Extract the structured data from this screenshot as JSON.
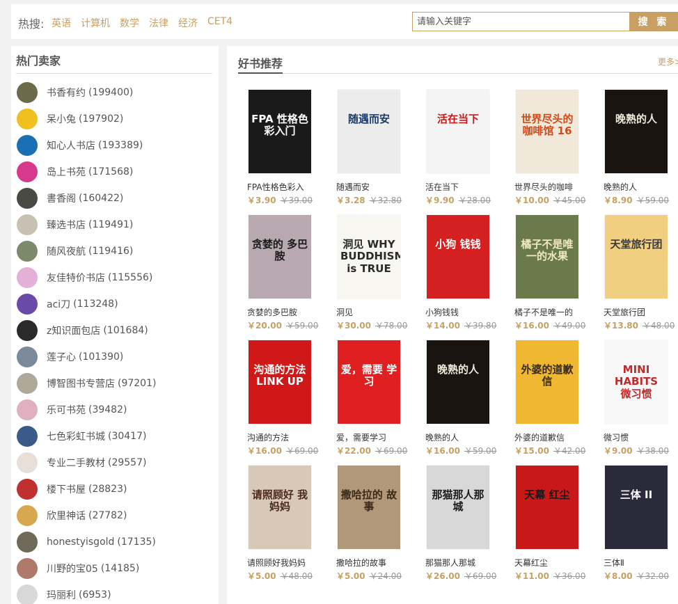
{
  "topbar": {
    "hot_label": "热搜:",
    "hot_tags": [
      "英语",
      "计算机",
      "数学",
      "法律",
      "经济",
      "CET4"
    ],
    "search_placeholder": "请输入关键字",
    "search_button": "搜 索"
  },
  "sidebar": {
    "title": "热门卖家",
    "sellers": [
      {
        "name": "书香有约",
        "count": "(199400)",
        "avatar_color": "#6b6b4a"
      },
      {
        "name": "呆小兔",
        "count": "(197902)",
        "avatar_color": "#f0c020"
      },
      {
        "name": "知心人书店",
        "count": "(193389)",
        "avatar_color": "#1b6fb3"
      },
      {
        "name": "岛上书苑",
        "count": "(171568)",
        "avatar_color": "#d63a8f"
      },
      {
        "name": "書香阁",
        "count": "(160422)",
        "avatar_color": "#4a4a44"
      },
      {
        "name": "臻选书店",
        "count": "(119491)",
        "avatar_color": "#c9c0b4"
      },
      {
        "name": "随风夜航",
        "count": "(119416)",
        "avatar_color": "#7a8a6a"
      },
      {
        "name": "友佳特价书店",
        "count": "(115556)",
        "avatar_color": "#e3b0d8"
      },
      {
        "name": "aci刀",
        "count": "(113248)",
        "avatar_color": "#6a4aa8"
      },
      {
        "name": "z知识面包店",
        "count": "(101684)",
        "avatar_color": "#2a2a2a"
      },
      {
        "name": "莲子心",
        "count": "(101390)",
        "avatar_color": "#7a8a9a"
      },
      {
        "name": "博智图书专营店",
        "count": "(97201)",
        "avatar_color": "#b0a898"
      },
      {
        "name": "乐可书苑",
        "count": "(39482)",
        "avatar_color": "#e0b0c0"
      },
      {
        "name": "七色彩虹书城",
        "count": "(30417)",
        "avatar_color": "#3a5a8a"
      },
      {
        "name": "专业二手教材",
        "count": "(29557)",
        "avatar_color": "#e8e0d8"
      },
      {
        "name": "楼下书屋",
        "count": "(28823)",
        "avatar_color": "#c03030"
      },
      {
        "name": "欣里神话",
        "count": "(27782)",
        "avatar_color": "#d8a850"
      },
      {
        "name": "honestyisgold",
        "count": "(17135)",
        "avatar_color": "#706858"
      },
      {
        "name": "川野的宝05",
        "count": "(14185)",
        "avatar_color": "#b07a6a"
      },
      {
        "name": "玛丽利",
        "count": "(6953)",
        "avatar_color": "#d8d8d8"
      }
    ]
  },
  "main": {
    "title": "好书推荐",
    "more": "更多>",
    "books": [
      {
        "title": "FPA性格色彩入",
        "price": "￥3.90",
        "old_price": "￥39.00",
        "cover_bg": "#1a1a1a",
        "cover_fg": "#ffffff",
        "cover_text": "FPA 性格色彩入门"
      },
      {
        "title": "随遇而安",
        "price": "￥3.28",
        "old_price": "￥32.80",
        "cover_bg": "#ececec",
        "cover_fg": "#1a3a6a",
        "cover_text": "随遇而安"
      },
      {
        "title": "活在当下",
        "price": "￥9.90",
        "old_price": "￥28.00",
        "cover_bg": "#f4f4f4",
        "cover_fg": "#c81a1a",
        "cover_text": "活在当下"
      },
      {
        "title": "世界尽头的咖啡",
        "price": "￥10.00",
        "old_price": "￥45.00",
        "cover_bg": "#f0e8d8",
        "cover_fg": "#d04a1a",
        "cover_text": "世界尽头的咖啡馆 16"
      },
      {
        "title": "晚熟的人",
        "price": "￥8.90",
        "old_price": "￥59.00",
        "cover_bg": "#1a1410",
        "cover_fg": "#f0e8d8",
        "cover_text": "晚熟的人"
      },
      {
        "title": "贪婪的多巴胺",
        "price": "￥20.00",
        "old_price": "￥59.00",
        "cover_bg": "#b8a8b0",
        "cover_fg": "#1a1a1a",
        "cover_text": "贪婪的 多巴胺"
      },
      {
        "title": "洞见",
        "price": "￥30.00",
        "old_price": "￥78.00",
        "cover_bg": "#f8f6f0",
        "cover_fg": "#2a2a2a",
        "cover_text": "洞见 WHY BUDDHISM is TRUE"
      },
      {
        "title": "小狗钱钱",
        "price": "￥14.00",
        "old_price": "￥39.80",
        "cover_bg": "#d42020",
        "cover_fg": "#ffffff",
        "cover_text": "小狗 钱钱"
      },
      {
        "title": "橘子不是唯一的",
        "price": "￥16.00",
        "old_price": "￥49.00",
        "cover_bg": "#6a7a4a",
        "cover_fg": "#f0e8c0",
        "cover_text": "橘子不是唯一的水果"
      },
      {
        "title": "天堂旅行团",
        "price": "￥13.80",
        "old_price": "￥48.00",
        "cover_bg": "#f0d080",
        "cover_fg": "#3a3a3a",
        "cover_text": "天堂旅行团"
      },
      {
        "title": "沟通的方法",
        "price": "￥16.00",
        "old_price": "￥69.00",
        "cover_bg": "#d01818",
        "cover_fg": "#ffffff",
        "cover_text": "沟通的方法 LINK UP"
      },
      {
        "title": "爱，需要学习",
        "price": "￥22.00",
        "old_price": "￥69.00",
        "cover_bg": "#e02020",
        "cover_fg": "#ffffff",
        "cover_text": "爱，需要 学习"
      },
      {
        "title": "晚熟的人",
        "price": "￥16.00",
        "old_price": "￥59.00",
        "cover_bg": "#1a1410",
        "cover_fg": "#f0e8d8",
        "cover_text": "晚熟的人"
      },
      {
        "title": "外婆的道歉信",
        "price": "￥15.00",
        "old_price": "￥42.00",
        "cover_bg": "#f0b830",
        "cover_fg": "#3a2a1a",
        "cover_text": "外婆的道歉信"
      },
      {
        "title": "微习惯",
        "price": "￥9.00",
        "old_price": "￥38.00",
        "cover_bg": "#f8f8f8",
        "cover_fg": "#c02a2a",
        "cover_text": "MINI HABITS 微习惯"
      },
      {
        "title": "请照顾好我妈妈",
        "price": "￥5.00",
        "old_price": "￥48.00",
        "cover_bg": "#d8c8b8",
        "cover_fg": "#4a2a1a",
        "cover_text": "请照顾好 我妈妈"
      },
      {
        "title": "撒哈拉的故事",
        "price": "￥5.00",
        "old_price": "￥24.00",
        "cover_bg": "#b09878",
        "cover_fg": "#3a2a1a",
        "cover_text": "撒哈拉的 故事"
      },
      {
        "title": "那猫那人那城",
        "price": "￥26.00",
        "old_price": "￥69.00",
        "cover_bg": "#d8d8d8",
        "cover_fg": "#1a1a1a",
        "cover_text": "那猫那人那城"
      },
      {
        "title": "天幕红尘",
        "price": "￥11.00",
        "old_price": "￥36.00",
        "cover_bg": "#c81818",
        "cover_fg": "#1a1a1a",
        "cover_text": "天幕 红尘"
      },
      {
        "title": "三体Ⅱ",
        "price": "￥8.00",
        "old_price": "￥32.00",
        "cover_bg": "#2a2a3a",
        "cover_fg": "#ffffff",
        "cover_text": "三体 II"
      }
    ]
  }
}
